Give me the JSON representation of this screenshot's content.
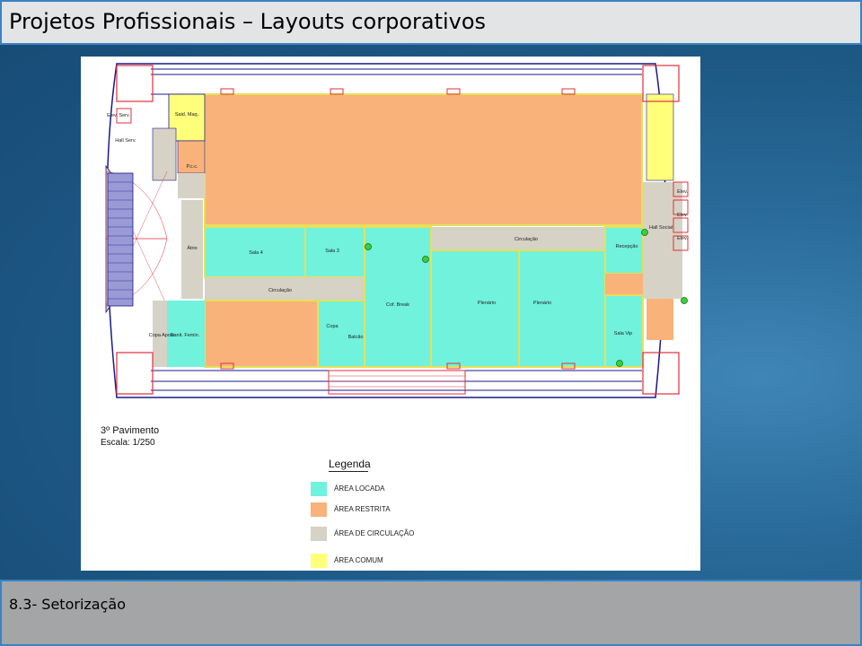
{
  "title": "Projetos Profissionais – Layouts corporativos",
  "footer": {
    "section": "8.3- Setorização"
  },
  "plan": {
    "floor": "3º Pavimento",
    "scale": "Escala: 1/250",
    "rooms": {
      "elev_serv": "Elev. Serv.",
      "hall_serv": "Hall Serv.",
      "said_maq": "Said. Maq.",
      "p_c_c": "P.c.c.",
      "atrio": "Átrio",
      "sala4": "Sala 4",
      "sala3": "Sala 3",
      "circulacao_left": "Circulação",
      "circulacao_right": "Circulação",
      "recepcao": "Recepção",
      "hall_social": "Hall Social",
      "elev1": "Elev.",
      "elev2": "Elev.",
      "elev3": "Elev.",
      "cof_break": "Cof. Break",
      "plenario1": "Plenário",
      "plenario2": "Plenário",
      "copa": "Copa",
      "balcao": "Balcão",
      "copa_apoio": "Copa Apoio",
      "sanit_femin": "Sanit. Femin.",
      "sala_vip": "Sala Vip"
    }
  },
  "legend": {
    "title": "Legenda",
    "items": [
      {
        "label": "ÁREA   LOCADA",
        "color": "#70f2dc"
      },
      {
        "label": "ÁREA RESTRITA",
        "color": "#f9b27a"
      },
      {
        "label": "ÁREA  DE CIRCULAÇÃO",
        "color": "#d6d2c5"
      },
      {
        "label": "ÁREA  COMUM",
        "color": "#ffff7a"
      }
    ]
  },
  "colors": {
    "locada": "#70f2dc",
    "restrita": "#f9b27a",
    "circulacao": "#d6d2c5",
    "comum": "#ffff7a",
    "wall": "#1a1a8c",
    "accent_red": "#e0303c"
  }
}
